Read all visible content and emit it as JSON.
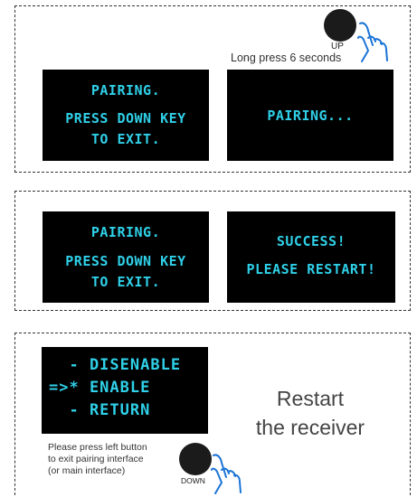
{
  "panel1": {
    "up_label": "UP",
    "long_press": "Long press 6 seconds",
    "screen_left": [
      "PAIRING.",
      "PRESS DOWN KEY",
      "TO EXIT."
    ],
    "screen_right": [
      "PAIRING..."
    ]
  },
  "panel2": {
    "screen_left": [
      "PAIRING.",
      "PRESS DOWN KEY",
      "TO EXIT."
    ],
    "screen_right": [
      "SUCCESS!",
      "PLEASE RESTART!"
    ]
  },
  "panel3": {
    "menu": [
      "  - DISENABLE",
      "=>* ENABLE",
      "  - RETURN"
    ],
    "note": [
      "Please press left button",
      "to exit pairing interface",
      "(or main interface)"
    ],
    "down_label": "DOWN",
    "restart": [
      "Restart",
      "the receiver"
    ]
  },
  "colors": {
    "screen_bg": "#000000",
    "screen_text": "#2fd0e8",
    "button": "#1b1b1b"
  },
  "icons": [
    "hand-pointer-icon"
  ]
}
